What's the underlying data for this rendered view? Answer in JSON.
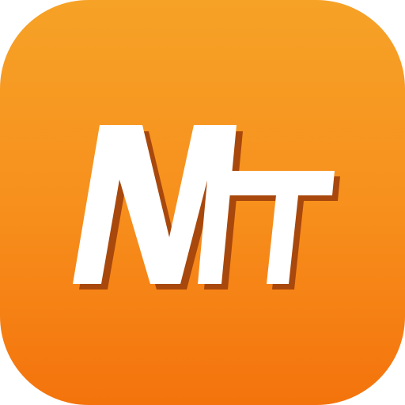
{
  "logo": {
    "glyph_large": "M",
    "glyph_small": "T",
    "background_top": "#f6a227",
    "background_bottom": "#f4730c",
    "glyph_fill": "#ffffff",
    "glyph_shadow": "#a9480c"
  }
}
